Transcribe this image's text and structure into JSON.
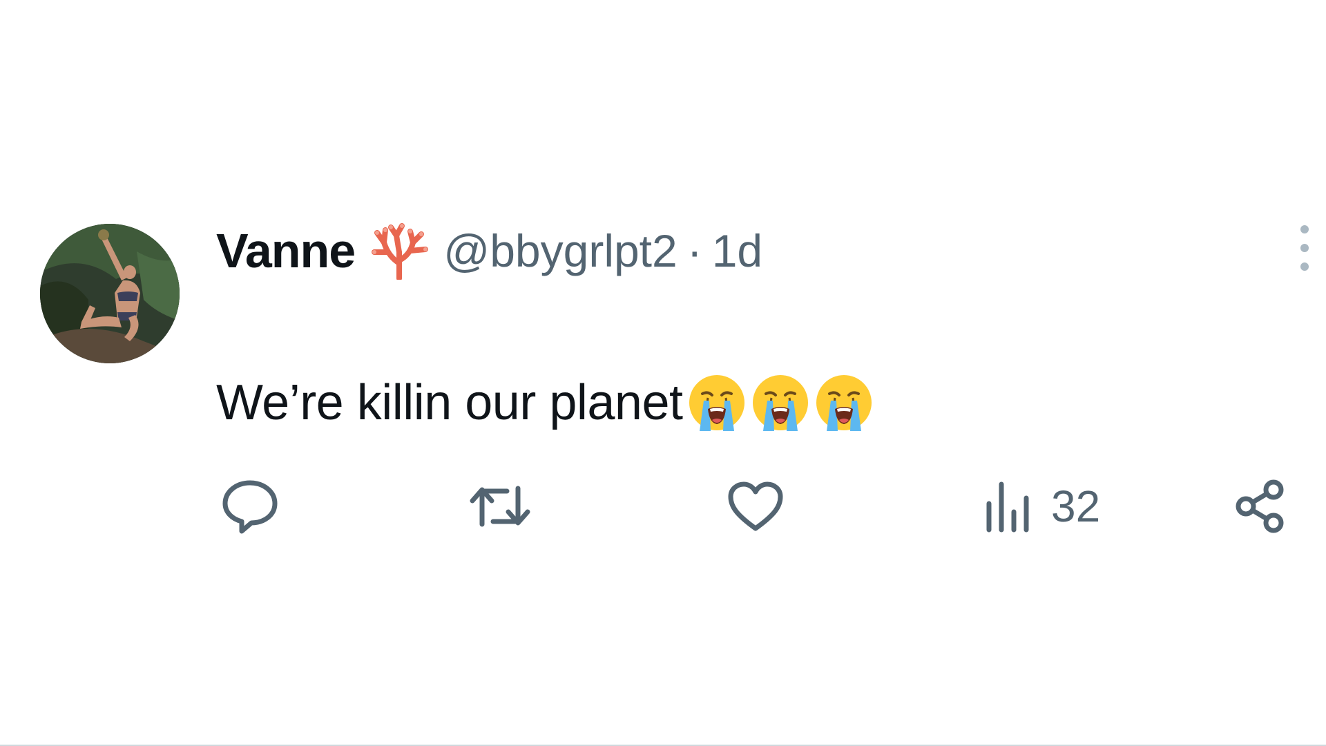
{
  "tweet": {
    "author": {
      "display_name": "Vanne",
      "name_emoji": "coral-icon",
      "handle": "@bbygrlpt2",
      "avatar": "avatar-photo"
    },
    "separator": "·",
    "timestamp": "1d",
    "text": "We’re killin our planet",
    "text_emojis": [
      "loudly-crying-face-icon",
      "loudly-crying-face-icon",
      "loudly-crying-face-icon"
    ],
    "actions": {
      "reply": {
        "icon": "reply-icon",
        "count": ""
      },
      "retweet": {
        "icon": "retweet-icon",
        "count": ""
      },
      "like": {
        "icon": "heart-icon",
        "count": ""
      },
      "views": {
        "icon": "views-icon",
        "count": "32"
      },
      "share": {
        "icon": "share-icon",
        "count": ""
      }
    }
  },
  "colors": {
    "text_primary": "#0f1419",
    "text_secondary": "#536471",
    "coral": "#e8664f",
    "background": "#ffffff"
  }
}
